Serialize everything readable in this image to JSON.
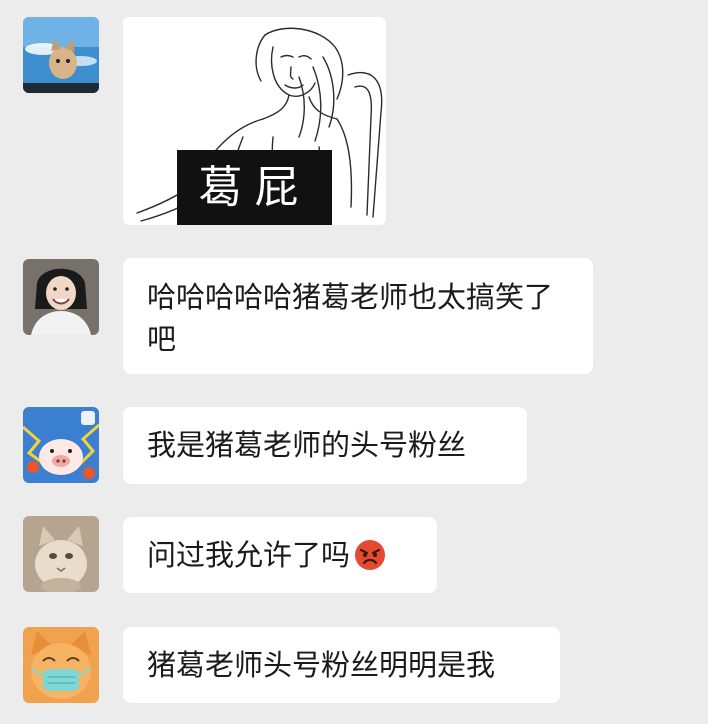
{
  "chat": {
    "messages": [
      {
        "type": "sticker",
        "sticker_caption": "葛屁",
        "avatar": "avatar-cat-sky-icon"
      },
      {
        "type": "text",
        "text": "哈哈哈哈哈猪葛老师也太搞笑了吧",
        "avatar": "avatar-smiling-woman-icon"
      },
      {
        "type": "text",
        "text": "我是猪葛老师的头号粉丝",
        "avatar": "avatar-cartoon-pig-icon"
      },
      {
        "type": "text",
        "text": "问过我允许了吗",
        "emoji": "angry-face-icon",
        "avatar": "avatar-cat-portrait-icon"
      },
      {
        "type": "text",
        "text": "猪葛老师头号粉丝明明是我",
        "avatar": "avatar-cat-mask-icon"
      }
    ]
  },
  "colors": {
    "background": "#ececec",
    "bubble": "#ffffff",
    "text": "#1b1b1b",
    "caption_bg": "#111111"
  }
}
